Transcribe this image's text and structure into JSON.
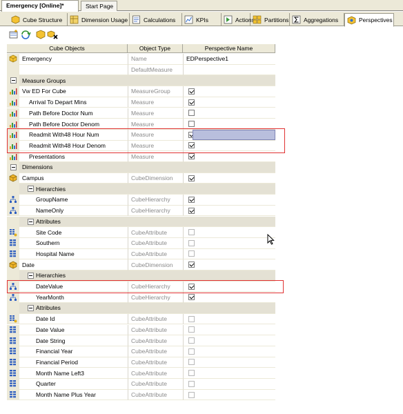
{
  "doc_tabs": [
    {
      "label": "Emergency [Online]*",
      "active": true
    },
    {
      "label": "Start Page",
      "active": false
    }
  ],
  "designer_tabs": [
    {
      "label": "Cube Structure",
      "icon": "cube-structure-icon",
      "active": false
    },
    {
      "label": "Dimension Usage",
      "icon": "dimension-usage-icon",
      "active": false
    },
    {
      "label": "Calculations",
      "icon": "calculations-icon",
      "active": false
    },
    {
      "label": "KPIs",
      "icon": "kpis-icon",
      "active": false
    },
    {
      "label": "Actions",
      "icon": "actions-icon",
      "active": false
    },
    {
      "label": "Partitions",
      "icon": "partitions-icon",
      "active": false
    },
    {
      "label": "Aggregations",
      "icon": "aggregations-icon",
      "active": false
    },
    {
      "label": "Perspectives",
      "icon": "perspectives-icon",
      "active": true
    }
  ],
  "toolbar": {
    "buttons": [
      "new-perspective-icon",
      "rename-perspective-icon",
      "delete-perspective-icon",
      "browse-perspective-icon"
    ]
  },
  "grid": {
    "headers": {
      "objects": "Cube Objects",
      "type": "Object Type",
      "perspective": "Perspective Name"
    },
    "rows": [
      {
        "kind": "item",
        "indent": 0,
        "icon": "cube-icon",
        "name": "Emergency",
        "type": "Name",
        "value": "EDPerspective1",
        "check": null
      },
      {
        "kind": "item",
        "indent": 0,
        "icon": "",
        "name": "",
        "type": "DefaultMeasure",
        "value": "",
        "check": null
      },
      {
        "kind": "group",
        "indent": 0,
        "name": "Measure Groups"
      },
      {
        "kind": "item",
        "indent": 0,
        "icon": "measure-group-icon",
        "name": "Vw ED For Cube",
        "type": "MeasureGroup",
        "check": true
      },
      {
        "kind": "item",
        "indent": 1,
        "icon": "measure-icon",
        "name": "Arrival To Depart Mins",
        "type": "Measure",
        "check": true
      },
      {
        "kind": "item",
        "indent": 1,
        "icon": "measure-icon",
        "name": "Path Before Doctor Num",
        "type": "Measure",
        "check": false
      },
      {
        "kind": "item",
        "indent": 1,
        "icon": "measure-icon",
        "name": "Path Before Doctor Denom",
        "type": "Measure",
        "check": false
      },
      {
        "kind": "item",
        "indent": 1,
        "icon": "measure-icon",
        "name": "Readmit With48 Hour Num",
        "type": "Measure",
        "check": true
      },
      {
        "kind": "item",
        "indent": 1,
        "icon": "measure-icon",
        "name": "Readmit With48 Hour Denom",
        "type": "Measure",
        "check": true
      },
      {
        "kind": "item",
        "indent": 1,
        "icon": "measure-icon",
        "name": "Presentations",
        "type": "Measure",
        "check": true
      },
      {
        "kind": "group",
        "indent": 0,
        "name": "Dimensions"
      },
      {
        "kind": "item",
        "indent": 0,
        "icon": "dimension-icon",
        "name": "Campus",
        "type": "CubeDimension",
        "check": true
      },
      {
        "kind": "group",
        "indent": 1,
        "name": "Hierarchies"
      },
      {
        "kind": "item",
        "indent": 2,
        "icon": "hierarchy-icon",
        "name": "GroupName",
        "type": "CubeHierarchy",
        "check": true
      },
      {
        "kind": "item",
        "indent": 2,
        "icon": "hierarchy-icon",
        "name": "NameOnly",
        "type": "CubeHierarchy",
        "check": true
      },
      {
        "kind": "group",
        "indent": 1,
        "name": "Attributes"
      },
      {
        "kind": "item",
        "indent": 2,
        "icon": "attribute-key-icon",
        "name": "Site Code",
        "type": "CubeAttribute",
        "check": false
      },
      {
        "kind": "item",
        "indent": 2,
        "icon": "attribute-icon",
        "name": "Southern",
        "type": "CubeAttribute",
        "check": false
      },
      {
        "kind": "item",
        "indent": 2,
        "icon": "attribute-icon",
        "name": "Hospital Name",
        "type": "CubeAttribute",
        "check": false
      },
      {
        "kind": "item",
        "indent": 0,
        "icon": "dimension-icon",
        "name": "Date",
        "type": "CubeDimension",
        "check": true
      },
      {
        "kind": "group",
        "indent": 1,
        "name": "Hierarchies"
      },
      {
        "kind": "item",
        "indent": 2,
        "icon": "hierarchy-icon",
        "name": "DateValue",
        "type": "CubeHierarchy",
        "check": true
      },
      {
        "kind": "item",
        "indent": 2,
        "icon": "hierarchy-icon",
        "name": "YearMonth",
        "type": "CubeHierarchy",
        "check": true
      },
      {
        "kind": "group",
        "indent": 1,
        "name": "Attributes"
      },
      {
        "kind": "item",
        "indent": 2,
        "icon": "attribute-key-icon",
        "name": "Date Id",
        "type": "CubeAttribute",
        "check": false
      },
      {
        "kind": "item",
        "indent": 2,
        "icon": "attribute-icon",
        "name": "Date Value",
        "type": "CubeAttribute",
        "check": false
      },
      {
        "kind": "item",
        "indent": 2,
        "icon": "attribute-icon",
        "name": "Date String",
        "type": "CubeAttribute",
        "check": false
      },
      {
        "kind": "item",
        "indent": 2,
        "icon": "attribute-icon",
        "name": "Financial Year",
        "type": "CubeAttribute",
        "check": false
      },
      {
        "kind": "item",
        "indent": 2,
        "icon": "attribute-icon",
        "name": "Financial Period",
        "type": "CubeAttribute",
        "check": false
      },
      {
        "kind": "item",
        "indent": 2,
        "icon": "attribute-icon",
        "name": "Month Name Left3",
        "type": "CubeAttribute",
        "check": false
      },
      {
        "kind": "item",
        "indent": 2,
        "icon": "attribute-icon",
        "name": "Quarter",
        "type": "CubeAttribute",
        "check": false
      },
      {
        "kind": "item",
        "indent": 2,
        "icon": "attribute-icon",
        "name": "Month Name Plus Year",
        "type": "CubeAttribute",
        "check": false
      }
    ]
  },
  "colors": {
    "highlight": "#e03030",
    "selection": "#b9bfdd",
    "chrome": "#ece9d8"
  }
}
